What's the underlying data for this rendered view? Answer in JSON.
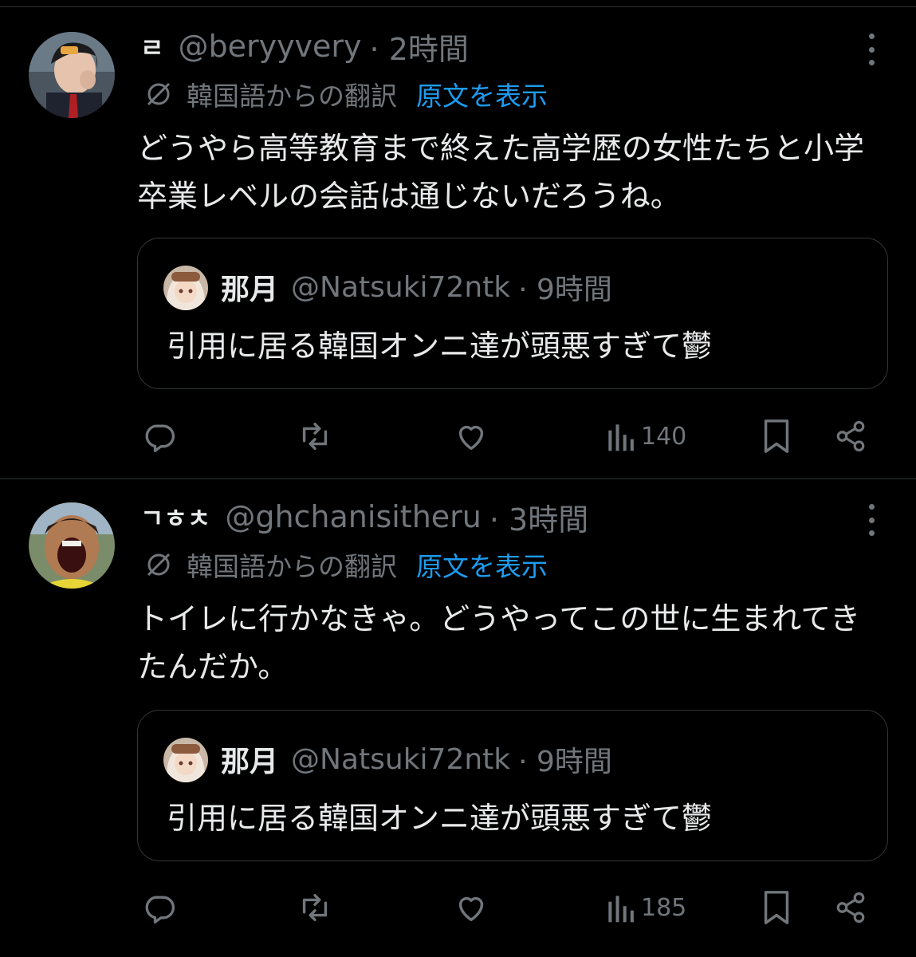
{
  "translate_label": "韓国語からの翻訳",
  "show_original_label": "原文を表示",
  "posts": [
    {
      "display_name": "ㄹ",
      "handle": "@beryyvery",
      "time": "· 2時間",
      "text": "どうやら高等教育まで終えた高学歴の女性たちと小学卒業レベルの会話は通じないだろうね。",
      "quote": {
        "name": "那月",
        "handle": "@Natsuki72ntk",
        "time": "· 9時間",
        "text": "引用に居る韓国オンニ達が頭悪すぎて鬱"
      },
      "views": "140"
    },
    {
      "display_name": "ㄱㅎㅊ",
      "handle": "@ghchanisitheru",
      "time": "· 3時間",
      "text": "トイレに行かなきゃ。どうやってこの世に生まれてきたんだか。",
      "quote": {
        "name": "那月",
        "handle": "@Natsuki72ntk",
        "time": "· 9時間",
        "text": "引用に居る韓国オンニ達が頭悪すぎて鬱"
      },
      "views": "185"
    }
  ],
  "colors": {
    "background": "#000000",
    "text": "#e7e9ea",
    "muted": "#71767b",
    "link": "#1d9bf0",
    "border": "#333639"
  },
  "icons": [
    "more-icon",
    "translate-icon",
    "reply-icon",
    "repost-icon",
    "like-icon",
    "views-icon",
    "bookmark-icon",
    "share-icon"
  ]
}
